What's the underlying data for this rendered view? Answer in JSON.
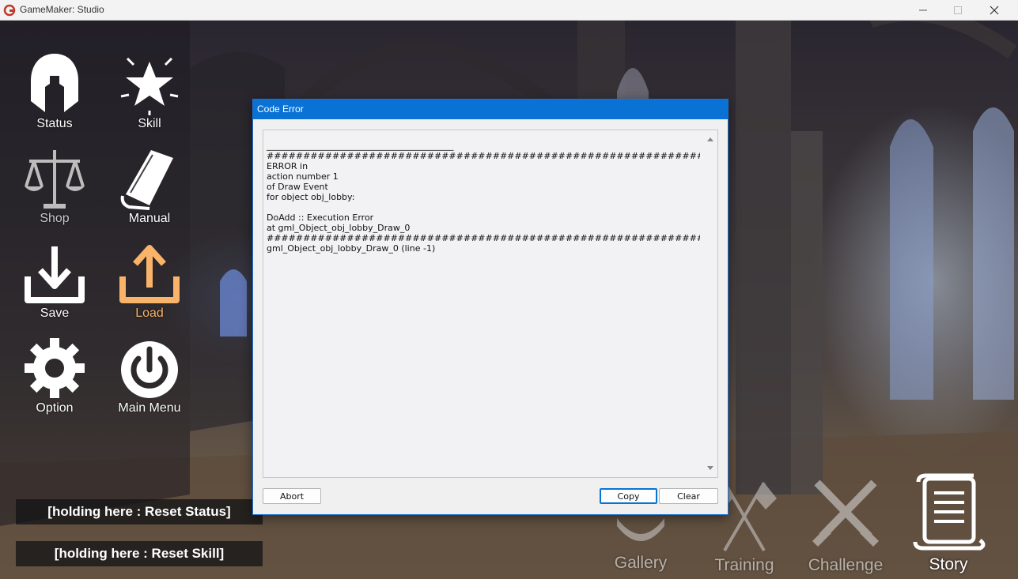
{
  "window": {
    "title": "GameMaker: Studio"
  },
  "menu": {
    "status": "Status",
    "skill": "Skill",
    "shop": "Shop",
    "manual": "Manual",
    "save": "Save",
    "load": "Load",
    "option": "Option",
    "main_menu": "Main Menu"
  },
  "reset": {
    "status": "[holding here : Reset Status]",
    "skill": "[holding here : Reset Skill]"
  },
  "bottom_nav": {
    "gallery": "Gallery",
    "training": "Training",
    "challenge": "Challenge",
    "story": "Story"
  },
  "dialog": {
    "title": "Code Error",
    "separator": "___________________________________________",
    "hash_line": "############################################################################################",
    "lines": [
      "ERROR in",
      "action number 1",
      "of Draw Event",
      "for object obj_lobby:",
      "",
      "DoAdd :: Execution Error",
      "at gml_Object_obj_lobby_Draw_0"
    ],
    "trace": "gml_Object_obj_lobby_Draw_0 (line -1)",
    "abort": "Abort",
    "copy": "Copy",
    "clear": "Clear"
  },
  "colors": {
    "accent": "#0a72d4",
    "load_active": "#f9b46a"
  }
}
